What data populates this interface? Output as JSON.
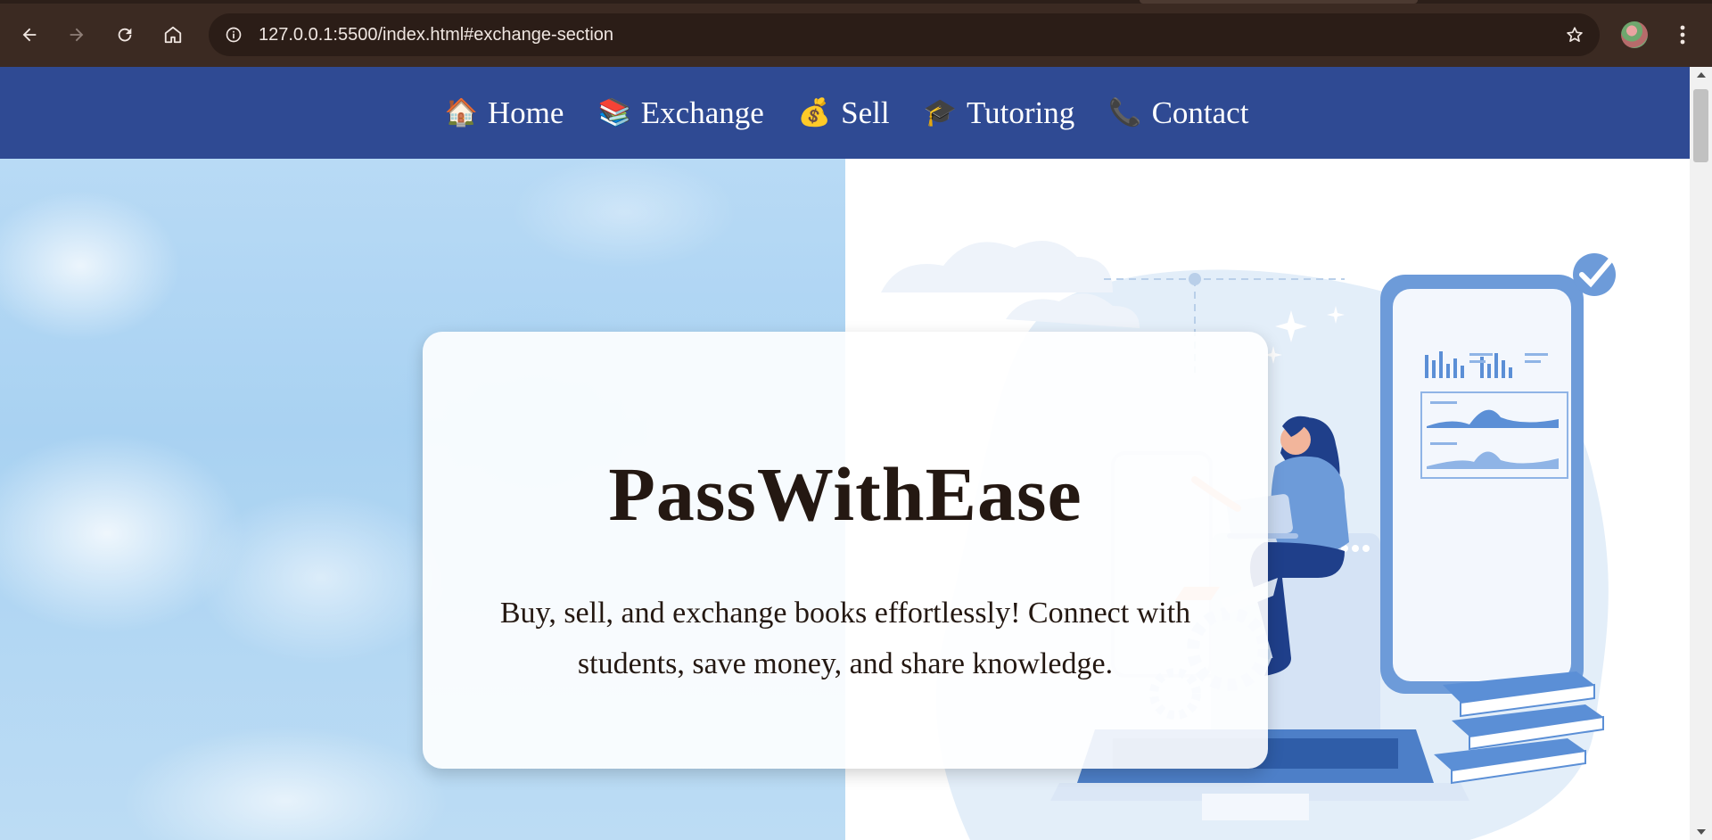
{
  "browser": {
    "url": "127.0.0.1:5500/index.html#exchange-section",
    "icons": {
      "back": "arrow-left-icon",
      "forward": "arrow-right-icon",
      "reload": "reload-icon",
      "home": "home-icon",
      "site_info": "info-icon",
      "bookmark": "star-icon",
      "menu": "kebab-menu-icon"
    }
  },
  "nav": {
    "items": [
      {
        "emoji": "🏠",
        "label": "Home"
      },
      {
        "emoji": "📚",
        "label": "Exchange"
      },
      {
        "emoji": "💰",
        "label": "Sell"
      },
      {
        "emoji": "🎓",
        "label": "Tutoring"
      },
      {
        "emoji": "📞",
        "label": "Contact"
      }
    ]
  },
  "hero": {
    "title": "PassWithEase",
    "description": "Buy, sell, and exchange books effortlessly! Connect with students, save money, and share knowledge."
  },
  "colors": {
    "nav_background": "#2f4a93",
    "title_text": "#241812",
    "browser_frame": "#3b2a22",
    "illustration_accent": "#5b8fd6"
  }
}
